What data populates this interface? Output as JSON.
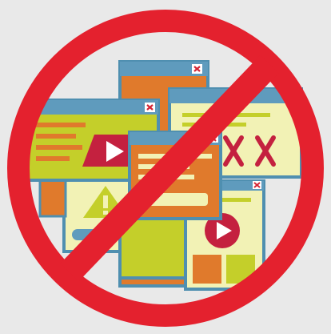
{
  "illustration": {
    "subject": "no-popups-prohibition-sign",
    "colors": {
      "background": "#e9e9e9",
      "prohibition_red": "#e4212e",
      "window_border": "#4f8fb0",
      "title_bar": "#5f9bbd",
      "close_red": "#d42535",
      "orange": "#e07a2c",
      "lime": "#c4cf2a",
      "pale_yellow": "#f2f2b5",
      "crimson": "#c4213f",
      "white": "#ffffff"
    },
    "icons": [
      "close-icon",
      "play-icon",
      "warning-icon",
      "x-mark-icon"
    ]
  }
}
